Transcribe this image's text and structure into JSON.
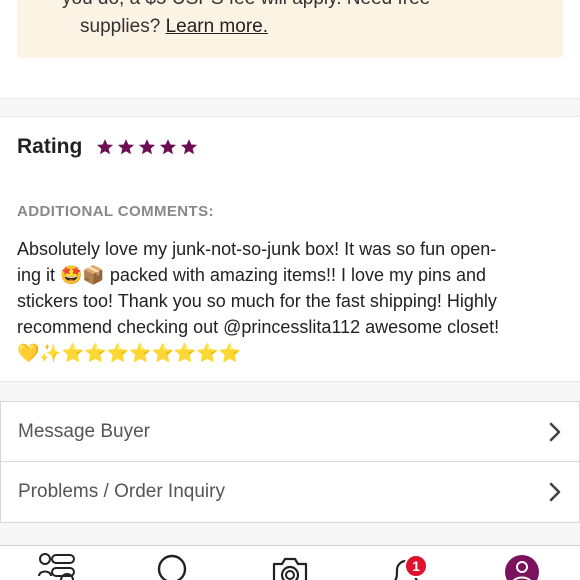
{
  "notice": {
    "line1": "you do, a $5 USPS fee will apply. Need free",
    "line2_prefix": "supplies? ",
    "line2_link": "Learn more."
  },
  "rating": {
    "label": "Rating",
    "stars": 5
  },
  "comments": {
    "label": "ADDITIONAL COMMENTS:",
    "lines": [
      "Absolutely love my junk-not-so-junk box! It was so fun open-",
      "ing it 🤩📦 packed with amazing items!! I love my pins and",
      "stickers too! Thank you so much for the fast shipping! Highly",
      "recommend checking out @princesslita112 awesome closet!",
      "💛✨⭐⭐⭐⭐⭐⭐⭐⭐"
    ]
  },
  "menu": {
    "items": [
      {
        "label": "Message Buyer"
      },
      {
        "label": "Problems / Order Inquiry"
      }
    ]
  },
  "tabbar": {
    "notification_count": "1",
    "icons": [
      "feed-icon",
      "search-icon",
      "camera-icon",
      "bell-icon",
      "account-icon"
    ]
  },
  "colors": {
    "star": "#6b0e52",
    "notice_bg": "#fbf3e3",
    "badge": "#e0102f"
  }
}
